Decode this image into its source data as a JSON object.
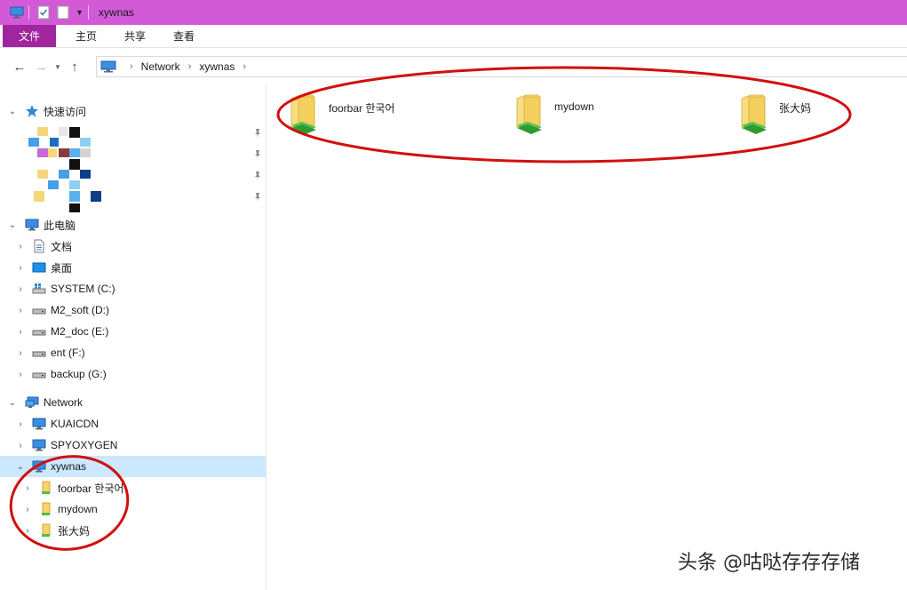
{
  "window": {
    "title": "xywnas",
    "title_bar_color": "#d35ad7"
  },
  "ribbon": {
    "file_tab": "文件",
    "tabs": [
      "主页",
      "共享",
      "查看"
    ],
    "file_tab_color": "#a0259f"
  },
  "address": {
    "breadcrumbs": [
      "Network",
      "xywnas"
    ]
  },
  "nav_pane": {
    "quick_access": {
      "label": "快速访问"
    },
    "this_pc": {
      "label": "此电脑",
      "items": [
        {
          "label": "文档",
          "icon": "document-icon"
        },
        {
          "label": "桌面",
          "icon": "desktop-icon"
        },
        {
          "label": "SYSTEM (C:)",
          "icon": "system-drive-icon"
        },
        {
          "label": "M2_soft (D:)",
          "icon": "drive-icon"
        },
        {
          "label": "M2_doc (E:)",
          "icon": "drive-icon"
        },
        {
          "label": "ent (F:)",
          "icon": "drive-icon"
        },
        {
          "label": "backup (G:)",
          "icon": "drive-icon"
        }
      ]
    },
    "network": {
      "label": "Network",
      "computers": [
        "KUAICDN",
        "SPYOXYGEN",
        "xywnas"
      ],
      "shares": [
        "foorbar 한국어",
        "mydown",
        "张大妈"
      ]
    }
  },
  "content": {
    "items": [
      {
        "label": "foorbar 한국어",
        "icon": "shared-folder-icon"
      },
      {
        "label": "mydown",
        "icon": "shared-folder-icon"
      },
      {
        "label": "张大妈",
        "icon": "shared-folder-icon"
      }
    ]
  },
  "watermark": "头条 @咕哒存存存储",
  "colors": {
    "selection": "#cce8ff",
    "annotation_ring": "#d10f0f"
  }
}
